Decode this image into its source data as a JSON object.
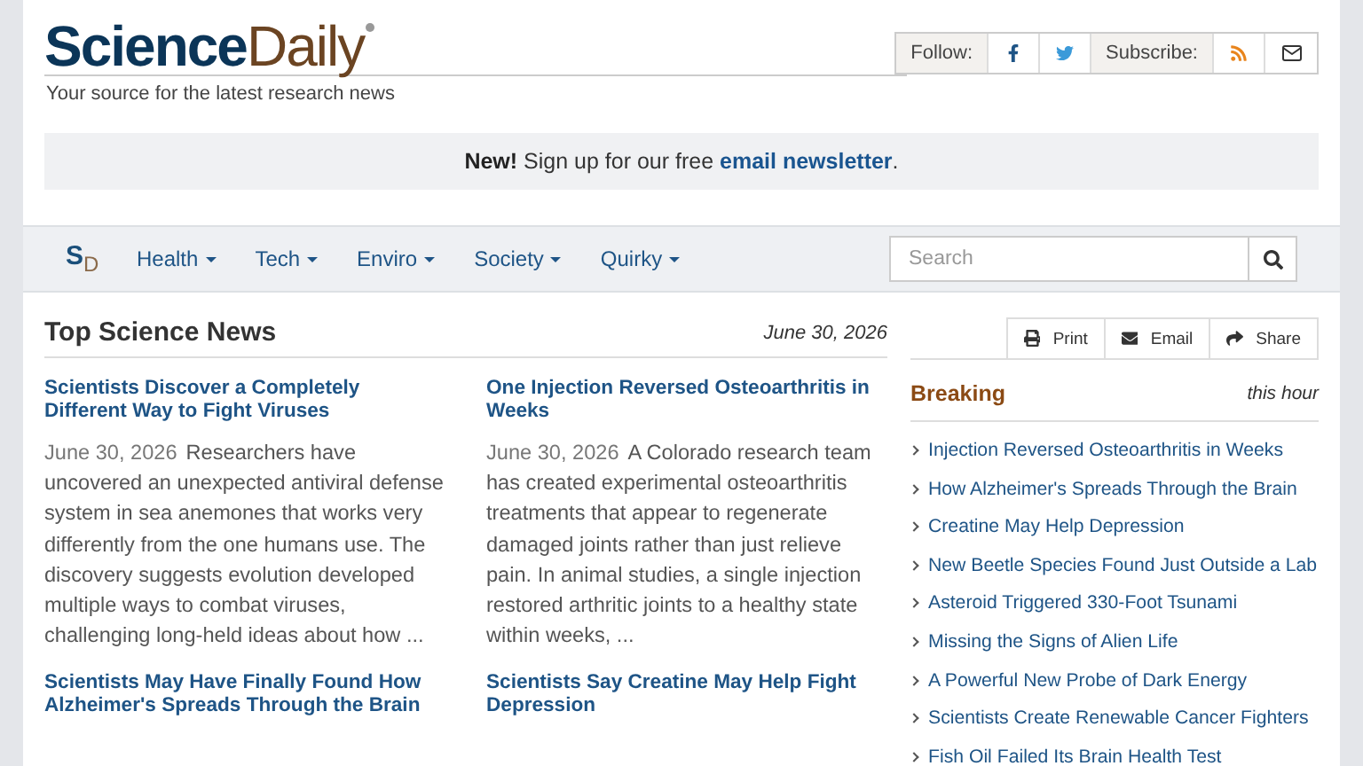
{
  "header": {
    "logo_first": "Science",
    "logo_second": "Daily",
    "tagline": "Your source for the latest research news",
    "follow_label": "Follow:",
    "subscribe_label": "Subscribe:"
  },
  "banner": {
    "before": "**New!** Sign up for our free ",
    "link": "email newsletter",
    "after": "."
  },
  "nav": {
    "logo_s": "S",
    "logo_d": "D",
    "items": [
      {
        "label": "Health"
      },
      {
        "label": "Tech"
      },
      {
        "label": "Enviro"
      },
      {
        "label": "Society"
      },
      {
        "label": "Quirky"
      }
    ],
    "search": {
      "placeholder": "Search"
    }
  },
  "main": {
    "title": "Top Science News",
    "date": "June 30, 2026",
    "stories": [
      {
        "headline": "Scientists Discover a Completely Different Way to Fight Viruses",
        "date": "June 30, 2026",
        "summary": "Researchers have uncovered an unexpected antiviral defense system in sea anemones that works very differently from the one humans use. The discovery suggests evolution developed multiple ways to combat viruses, challenging long-held ideas about how ..."
      },
      {
        "headline": "One Injection Reversed Osteoarthritis in Weeks",
        "date": "June 30, 2026",
        "summary": "A Colorado research team has created experimental osteoarthritis treatments that appear to regenerate damaged joints rather than just relieve pain. In animal studies, a single injection restored arthritic joints to a healthy state within weeks, ..."
      },
      {
        "headline": "Scientists May Have Finally Found How Alzheimer's Spreads Through the Brain"
      },
      {
        "headline": "Scientists Say Creatine May Help Fight Depression"
      }
    ]
  },
  "sidebar": {
    "tools": [
      {
        "kind": "print",
        "label": "Print"
      },
      {
        "kind": "email",
        "label": "Email"
      },
      {
        "kind": "share",
        "label": "Share"
      }
    ],
    "title": "Breaking",
    "subtitle": "this hour",
    "items": [
      "Injection Reversed Osteoarthritis in Weeks",
      "How Alzheimer's Spreads Through the Brain",
      "Creatine May Help Depression",
      "New Beetle Species Found Just Outside a Lab",
      "Asteroid Triggered 330-Foot Tsunami",
      "Missing the Signs of Alien Life",
      "A Powerful New Probe of Dark Energy",
      "Scientists Create Renewable Cancer Fighters",
      "Fish Oil Failed Its Brain Health Test"
    ]
  }
}
